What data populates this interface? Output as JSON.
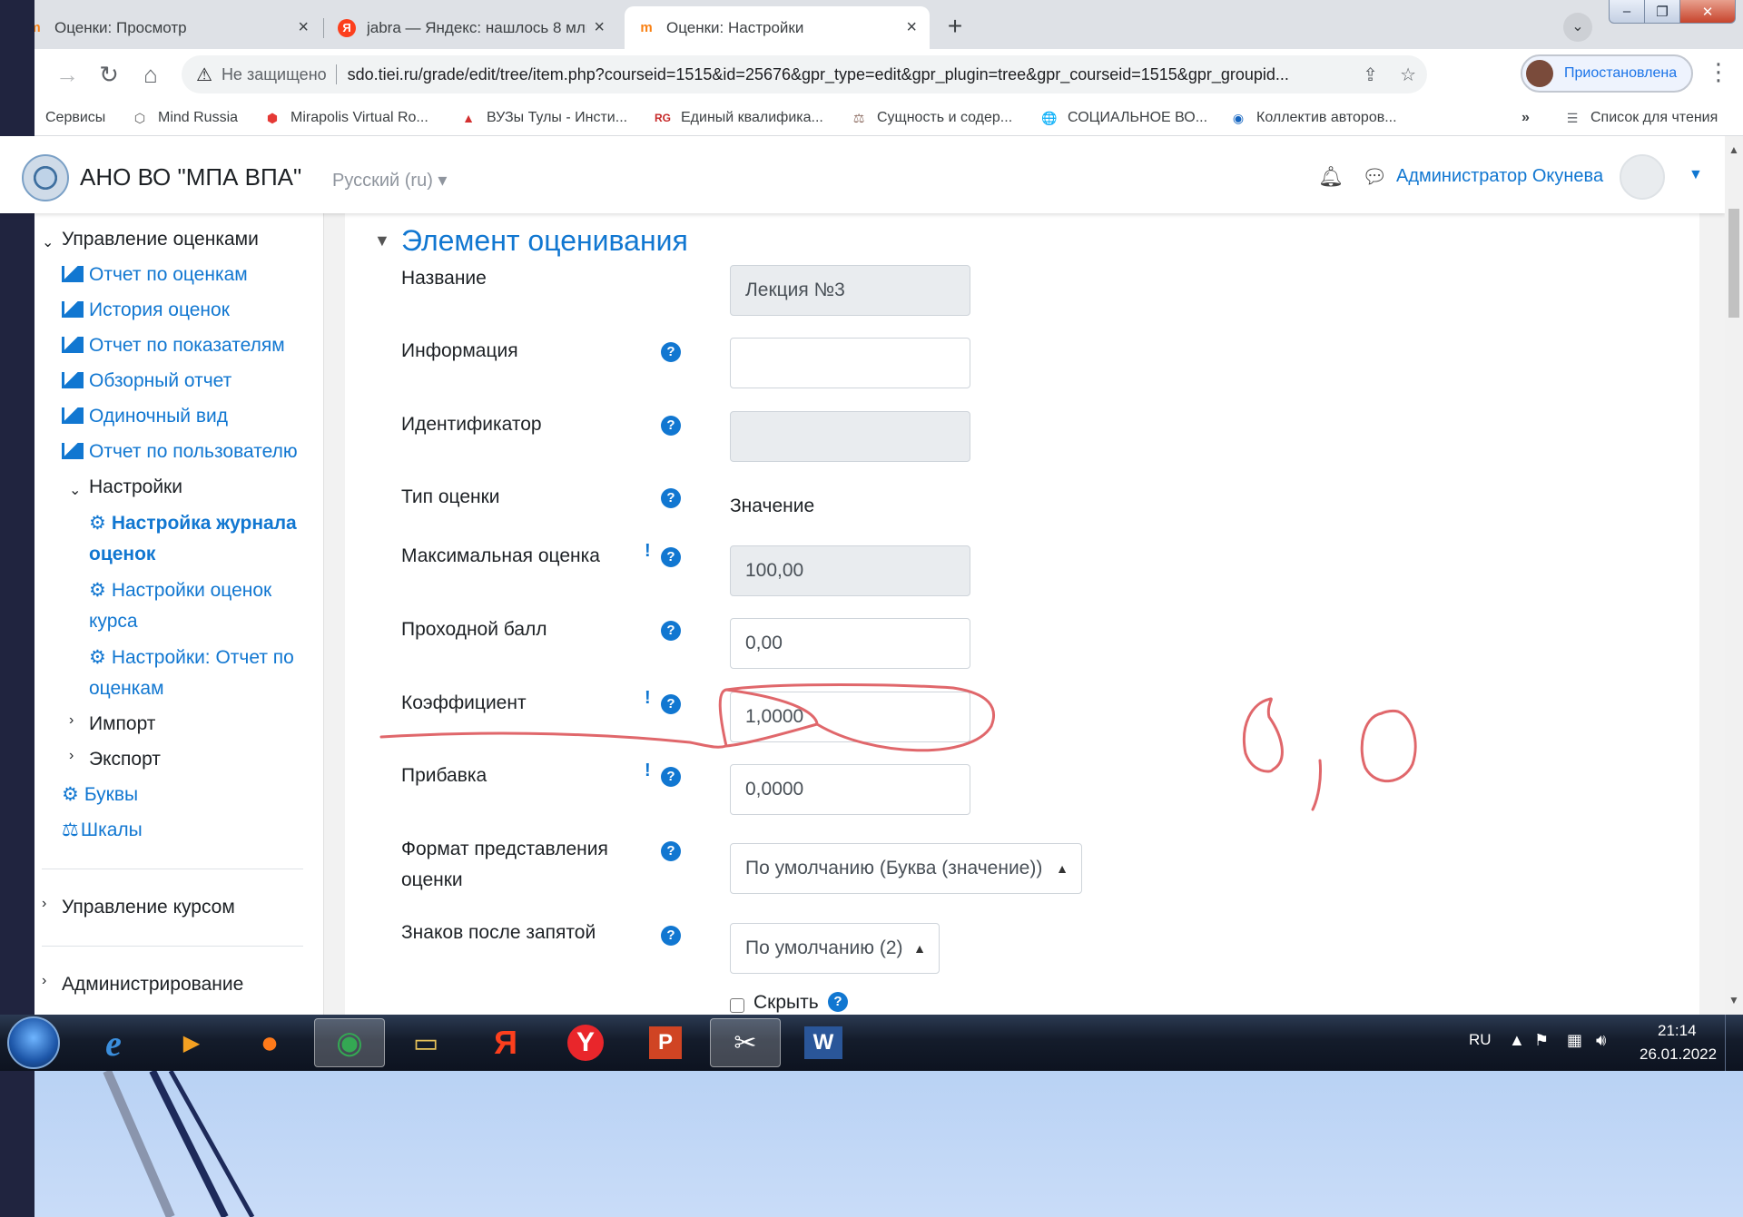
{
  "browser": {
    "tabs": [
      {
        "title": "Оценки: Просмотр",
        "favicon": "moodle-icon",
        "active": false
      },
      {
        "title": "jabra — Яндекс: нашлось 8 млн",
        "favicon": "yandex-icon",
        "active": false
      },
      {
        "title": "Оценки: Настройки",
        "favicon": "moodle-icon",
        "active": true
      }
    ],
    "not_secure_label": "Не защищено",
    "url": "sdo.tiei.ru/grade/edit/tree/item.php?courseid=1515&id=25676&gpr_type=edit&gpr_plugin=tree&gpr_courseid=1515&gpr_groupid...",
    "profile_label": "Приостановлена",
    "bookmarks": [
      {
        "label": "Сервисы",
        "icon": "apps-grid-icon"
      },
      {
        "label": "Mind Russia",
        "icon": "hexagon-icon"
      },
      {
        "label": "Mirapolis Virtual Ro...",
        "icon": "mirapolis-icon"
      },
      {
        "label": "ВУЗы Тулы - Инсти...",
        "icon": "triangle-icon"
      },
      {
        "label": "Единый квалифика...",
        "icon": "rg-icon"
      },
      {
        "label": "Сущность и содер...",
        "icon": "scales-icon"
      },
      {
        "label": "СОЦИАЛЬНОЕ ВО...",
        "icon": "globe-icon"
      },
      {
        "label": "Коллектив авторов...",
        "icon": "eye-icon"
      }
    ],
    "bookmarks_more": "»",
    "reading_list_label": "Список для чтения"
  },
  "moodle": {
    "site_name": "АНО ВО \"МПА ВПА\"",
    "language": "Русский (ru) ▾",
    "user_name": "Администратор Окунева"
  },
  "drawer": {
    "grades_admin": "Управление оценками",
    "links": [
      "Отчет по оценкам",
      "История оценок",
      "Отчет по показателям",
      "Обзорный отчет",
      "Одиночный вид",
      "Отчет по пользователю"
    ],
    "settings_label": "Настройки",
    "settings_items": [
      {
        "line1": "Настройка журнала",
        "line2": "оценок",
        "active": true
      },
      {
        "line1": "Настройки оценок",
        "line2": "курса",
        "active": false
      },
      {
        "line1": "Настройки: Отчет по",
        "line2": "оценкам",
        "active": false
      }
    ],
    "import_label": "Импорт",
    "export_label": "Экспорт",
    "letters_label": "Буквы",
    "scales_label": "Шкалы",
    "course_admin_label": "Управление курсом",
    "site_admin_label": "Администрирование"
  },
  "form": {
    "section_title": "Элемент оценивания",
    "name_label": "Название",
    "name_value": "Лекция №3",
    "info_label": "Информация",
    "info_value": "",
    "idnumber_label": "Идентификатор",
    "idnumber_value": "",
    "gradetype_label": "Тип оценки",
    "gradetype_value": "Значение",
    "maxgrade_label": "Максимальная оценка",
    "maxgrade_value": "100,00",
    "pass_label": "Проходной балл",
    "pass_value": "0,00",
    "multiplier_label": "Коэффициент",
    "multiplier_value": "1,0000",
    "offset_label": "Прибавка",
    "offset_value": "0,0000",
    "display_label_line1": "Формат представления",
    "display_label_line2": "оценки",
    "display_value": "По умолчанию (Буква (значение))",
    "decimals_label": "Знаков после запятой",
    "decimals_value": "По умолчанию (2)",
    "hidden_label": "Скрыть"
  },
  "annotation": {
    "handwritten_text": "0,0",
    "color": "#e0676b"
  },
  "taskbar": {
    "apps": [
      "ie-icon",
      "media-player-icon",
      "firefox-icon",
      "chrome-icon",
      "explorer-icon",
      "yandex-icon",
      "yandex-browser-icon",
      "powerpoint-icon",
      "snipping-tool-icon",
      "word-icon"
    ],
    "active_app": "chrome-icon",
    "language": "RU",
    "time": "21:14",
    "date": "26.01.2022"
  },
  "colors": {
    "moodle_link": "#1177d1",
    "taskbar": "#141c2b",
    "tab_strip": "#dee1e6"
  }
}
